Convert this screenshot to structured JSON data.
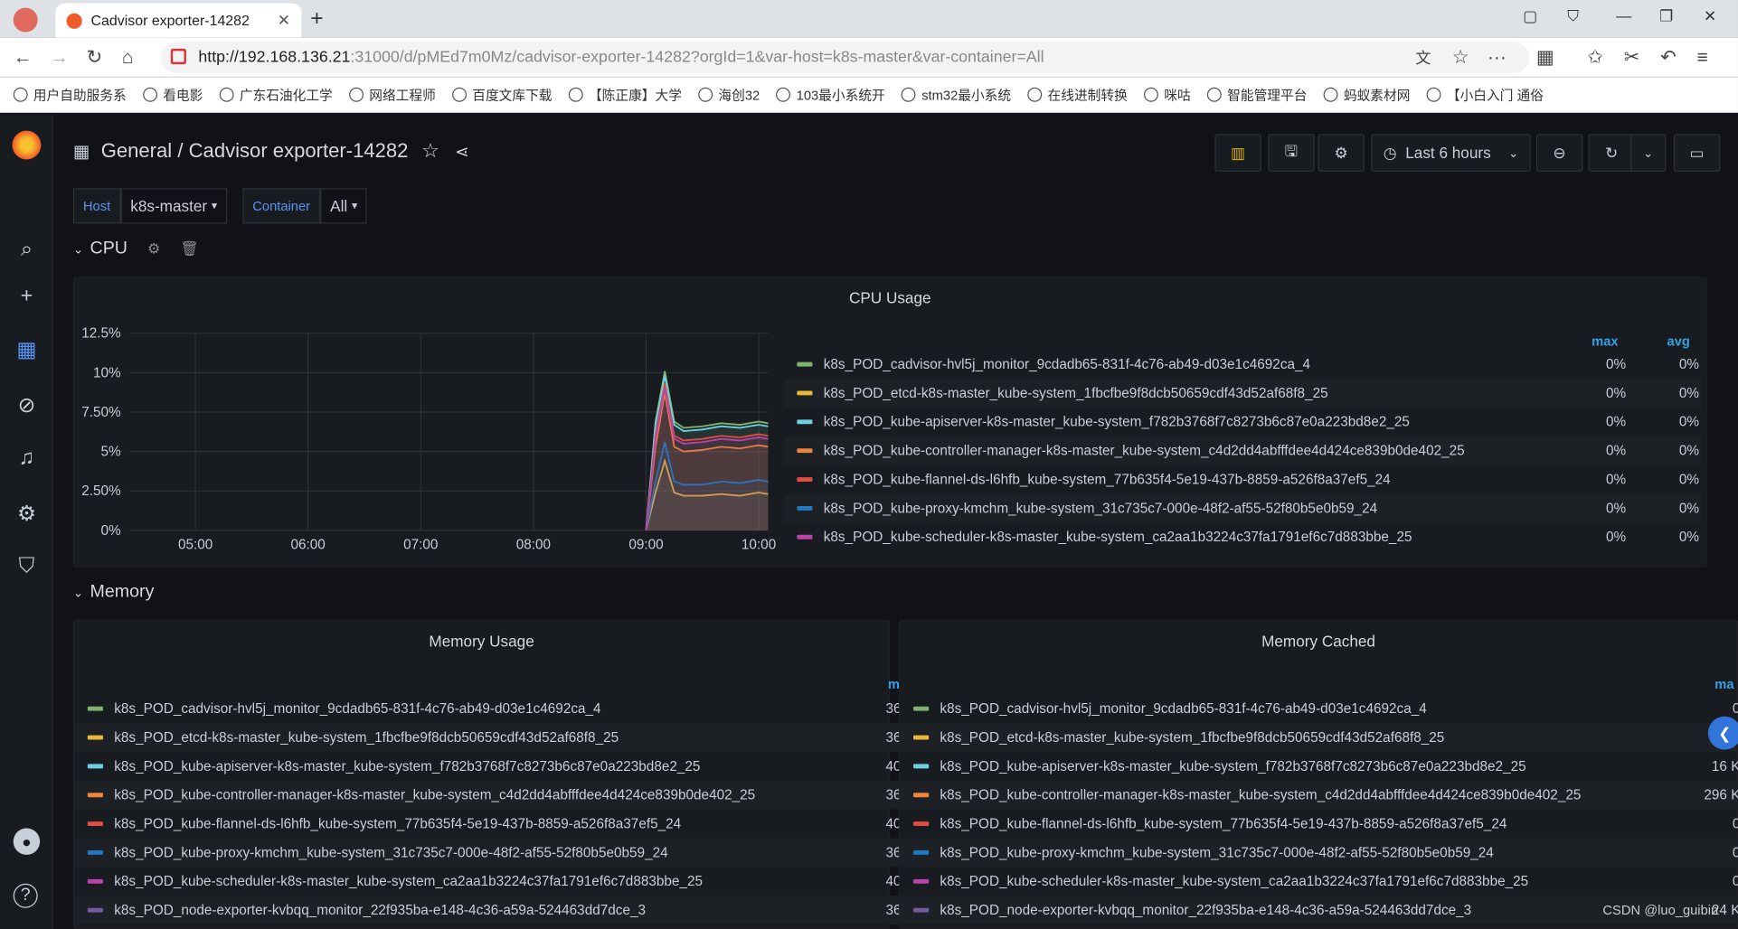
{
  "browser": {
    "tab_title": "Cadvisor exporter-14282",
    "url_host": "http://192.168.136.21",
    "url_path": ":31000/d/pMEd7m0Mz/cadvisor-exporter-14282?orgId=1&var-host=k8s-master&var-container=All",
    "bookmarks": [
      "用户自助服务系",
      "看电影",
      "广东石油化工学",
      "网络工程师",
      "百度文库下载",
      "【陈正康】大学",
      "海创32",
      "103最小系统开",
      "stm32最小系统",
      "在线进制转换",
      "咪咕",
      "智能管理平台",
      "蚂蚁素材网",
      "【小白入门 通俗"
    ]
  },
  "dashboard": {
    "folder": "General",
    "title": "/ Cadvisor exporter-14282",
    "time_range": "Last 6 hours"
  },
  "variables": [
    {
      "label": "Host",
      "value": "k8s-master"
    },
    {
      "label": "Container",
      "value": "All"
    }
  ],
  "rows": {
    "cpu": "CPU",
    "memory": "Memory"
  },
  "cpu_panel": {
    "title": "CPU Usage",
    "col_max": "max",
    "col_avg": "avg"
  },
  "mem_usage": {
    "title": "Memory Usage",
    "col": "m"
  },
  "mem_cached": {
    "title": "Memory Cached",
    "col": "ma"
  },
  "colors": {
    "green": "#7eb26d",
    "yellow": "#eab839",
    "cyan": "#6ed0e0",
    "orange": "#ef843c",
    "red": "#e24d42",
    "blue": "#1f78c1",
    "pink": "#ba43a9",
    "purple": "#705da0"
  },
  "series": [
    {
      "name": "k8s_POD_cadvisor-hvl5j_monitor_9cdadb65-831f-4c76-ab49-d03e1c4692ca_4",
      "color": "#7eb26d",
      "cpu_max": "0%",
      "cpu_avg": "0%",
      "mem": "36",
      "cached": "0"
    },
    {
      "name": "k8s_POD_etcd-k8s-master_kube-system_1fbcfbe9f8dcb50659cdf43d52af68f8_25",
      "color": "#eab839",
      "cpu_max": "0%",
      "cpu_avg": "0%",
      "mem": "36",
      "cached": "0"
    },
    {
      "name": "k8s_POD_kube-apiserver-k8s-master_kube-system_f782b3768f7c8273b6c87e0a223bd8e2_25",
      "color": "#6ed0e0",
      "cpu_max": "0%",
      "cpu_avg": "0%",
      "mem": "40",
      "cached": "16 K"
    },
    {
      "name": "k8s_POD_kube-controller-manager-k8s-master_kube-system_c4d2dd4abfffdee4d424ce839b0de402_25",
      "color": "#ef843c",
      "cpu_max": "0%",
      "cpu_avg": "0%",
      "mem": "36",
      "cached": "296 K"
    },
    {
      "name": "k8s_POD_kube-flannel-ds-l6hfb_kube-system_77b635f4-5e19-437b-8859-a526f8a37ef5_24",
      "color": "#e24d42",
      "cpu_max": "0%",
      "cpu_avg": "0%",
      "mem": "40",
      "cached": "0"
    },
    {
      "name": "k8s_POD_kube-proxy-kmchm_kube-system_31c735c7-000e-48f2-af55-52f80b5e0b59_24",
      "color": "#1f78c1",
      "cpu_max": "0%",
      "cpu_avg": "0%",
      "mem": "36",
      "cached": "0"
    },
    {
      "name": "k8s_POD_kube-scheduler-k8s-master_kube-system_ca2aa1b3224c37fa1791ef6c7d883bbe_25",
      "color": "#ba43a9",
      "cpu_max": "0%",
      "cpu_avg": "0%",
      "mem": "40",
      "cached": "0"
    },
    {
      "name": "k8s_POD_node-exporter-kvbqq_monitor_22f935ba-e148-4c36-a59a-524463dd7dce_3",
      "color": "#705da0",
      "mem": "36",
      "cached": "24 K"
    }
  ],
  "chart_data": {
    "type": "line",
    "title": "CPU Usage",
    "y_ticks": [
      "0%",
      "2.50%",
      "5%",
      "7.50%",
      "10%",
      "12.5%"
    ],
    "x_ticks": [
      "05:00",
      "06:00",
      "07:00",
      "08:00",
      "09:00",
      "10:00"
    ],
    "ylim": [
      0,
      12.5
    ],
    "xlim": [
      "04:25",
      "10:05"
    ],
    "x": [
      "09:00",
      "09:05",
      "09:10",
      "09:15",
      "09:20",
      "09:30",
      "09:40",
      "09:50",
      "10:00",
      "10:05"
    ],
    "series": [
      {
        "name": "k8s_POD_cadvisor-hvl5j_monitor_9cdadb65-831f-4c76-ab49-d03e1c4692ca_4",
        "color": "#7eb26d",
        "values": [
          0,
          6.9,
          10.1,
          6.9,
          6.5,
          6.6,
          6.8,
          6.7,
          6.9,
          6.8
        ]
      },
      {
        "name": "k8s_POD_etcd-k8s-master_kube-system_1fbcfbe9f8dcb50659cdf43d52af68f8_25",
        "color": "#eab839",
        "values": [
          0,
          2.4,
          4.4,
          2.4,
          2.2,
          2.2,
          2.3,
          2.2,
          2.4,
          2.3
        ]
      },
      {
        "name": "k8s_POD_kube-apiserver-k8s-master_kube-system_f782b3768f7c8273b6c87e0a223bd8e2_25",
        "color": "#6ed0e0",
        "values": [
          0,
          6.7,
          9.8,
          6.7,
          6.3,
          6.4,
          6.6,
          6.5,
          6.7,
          6.6
        ]
      },
      {
        "name": "k8s_POD_kube-controller-manager-k8s-master_kube-system_c4d2dd4abfffdee4d424ce839b0de402_25",
        "color": "#ef843c",
        "values": [
          0,
          5.3,
          8.7,
          5.3,
          5.0,
          5.1,
          5.3,
          5.2,
          5.4,
          5.3
        ]
      },
      {
        "name": "k8s_POD_kube-flannel-ds-l6hfb_kube-system_77b635f4-5e19-437b-8859-a526f8a37ef5_24",
        "color": "#e24d42",
        "values": [
          0,
          6.0,
          9.3,
          6.0,
          5.7,
          5.8,
          6.0,
          5.9,
          6.1,
          6.0
        ]
      },
      {
        "name": "k8s_POD_kube-proxy-kmchm_kube-system_31c735c7-000e-48f2-af55-52f80b5e0b59_24",
        "color": "#1f78c1",
        "values": [
          0,
          3.1,
          5.6,
          3.1,
          2.9,
          2.9,
          3.1,
          3.0,
          3.2,
          3.1
        ]
      },
      {
        "name": "k8s_POD_kube-scheduler-k8s-master_kube-system_ca2aa1b3224c37fa1791ef6c7d883bbe_25",
        "color": "#ba43a9",
        "values": [
          0,
          5.8,
          9.0,
          5.8,
          5.5,
          5.6,
          5.8,
          5.7,
          5.9,
          5.8
        ]
      }
    ]
  },
  "watermark": "CSDN @luo_guibin"
}
